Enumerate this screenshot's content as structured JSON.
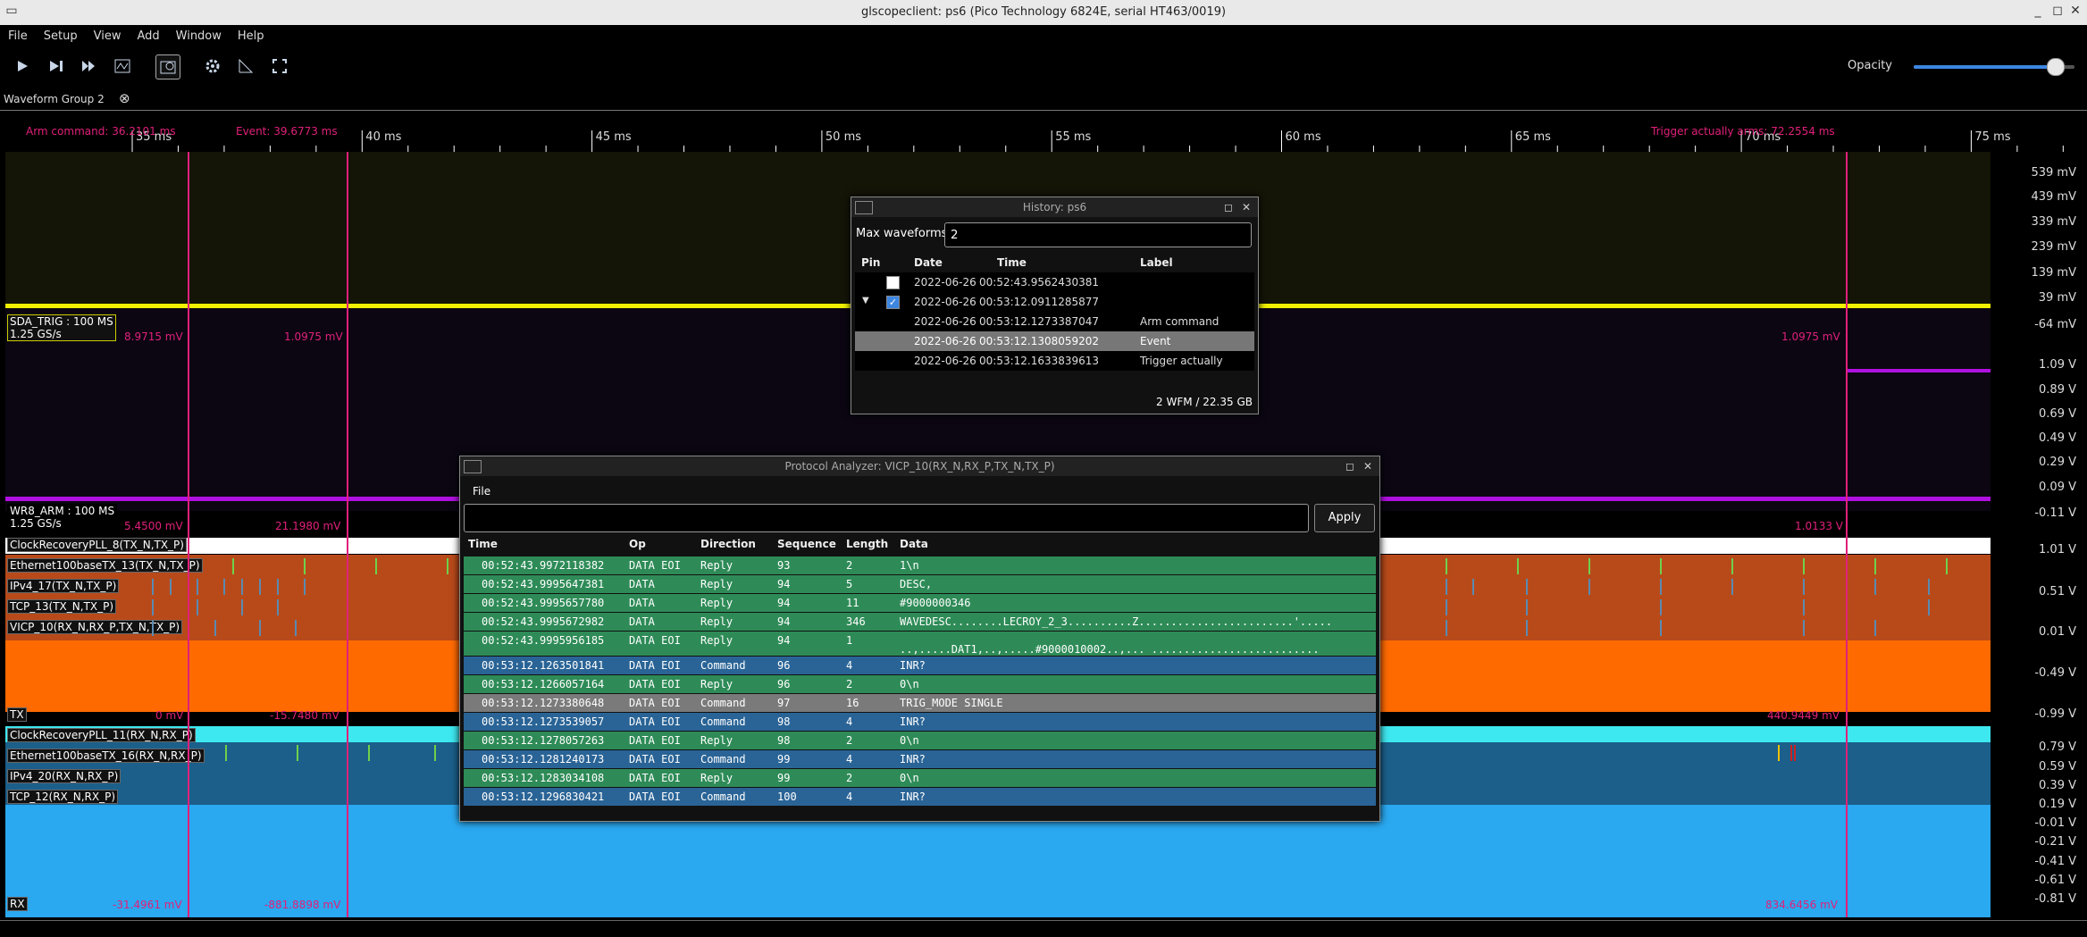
{
  "window": {
    "title": "glscopeclient: ps6 (Pico Technology 6824E, serial HT463/0019)",
    "min": "_",
    "max": "◻",
    "close": "✕"
  },
  "menu": [
    "File",
    "Setup",
    "View",
    "Add",
    "Window",
    "Help"
  ],
  "toolbar": {
    "opacity_label": "Opacity",
    "opacity_value": 0.88
  },
  "tab": {
    "label": "Waveform Group 2",
    "close": "⊗"
  },
  "ruler": {
    "ticks": [
      "35 ms",
      "40 ms",
      "45 ms",
      "50 ms",
      "55 ms",
      "60 ms",
      "65 ms",
      "70 ms",
      "75 ms"
    ],
    "markers": {
      "arm": "Arm command: 36.2101 ms",
      "event": "Event: 39.6773 ms",
      "trigger": "Trigger actually arms: 72.2554 ms"
    }
  },
  "scale": [
    "539 mV",
    "439 mV",
    "339 mV",
    "239 mV",
    "139 mV",
    "39 mV",
    "-64 mV",
    "1.09 V",
    "0.89 V",
    "0.69 V",
    "0.49 V",
    "0.29 V",
    "0.09 V",
    "-0.11 V",
    "1.01 V",
    "0.51 V",
    "0.01 V",
    "-0.49 V",
    "-0.99 V",
    "0.79 V",
    "0.59 V",
    "0.39 V",
    "0.19 V",
    "-0.01 V",
    "-0.21 V",
    "-0.41 V",
    "-0.61 V",
    "-0.81 V"
  ],
  "channels": {
    "sda_trig": {
      "name": "SDA_TRIG : 100 MS",
      "rate": "1.25 GS/s",
      "v1": "8.9715 mV",
      "v2": "1.0975 mV",
      "v3": "1.0975 mV"
    },
    "wr8_arm": {
      "name": "WR8_ARM : 100 MS",
      "rate": "1.25 GS/s",
      "v1": "5.4500 mV",
      "v2": "21.1980 mV",
      "v3": "1.0133 V"
    },
    "tx": {
      "name": "TX",
      "v1": "0 mV",
      "v2": "-15.7480 mV",
      "v3": "440.9449 mV"
    },
    "rx": {
      "name": "RX",
      "v1": "-31.4961 mV",
      "v2": "-881.8898 mV",
      "v3": "834.6456 mV"
    },
    "tx_decodes": [
      "ClockRecoveryPLL_8(TX_N,TX_P)",
      "Ethernet100baseTX_13(TX_N,TX_P)",
      "IPv4_17(TX_N,TX_P)",
      "TCP_13(TX_N,TX_P)",
      "VICP_10(RX_N,RX_P,TX_N,TX_P)"
    ],
    "rx_decodes": [
      "ClockRecoveryPLL_11(RX_N,RX_P)",
      "Ethernet100baseTX_16(RX_N,RX_P)",
      "IPv4_20(RX_N,RX_P)",
      "TCP_12(RX_N,RX_P)"
    ]
  },
  "history": {
    "title": "History: ps6",
    "max_label": "Max waveforms",
    "max_value": "2",
    "headers": [
      "Pin",
      "Date",
      "Time",
      "Label"
    ],
    "rows": [
      {
        "date": "2022-06-26",
        "time": "00:52:43.9562430381",
        "label": ""
      },
      {
        "date": "2022-06-26",
        "time": "00:53:12.0911285877",
        "label": ""
      },
      {
        "date": "2022-06-26",
        "time": "00:53:12.1273387047",
        "label": "Arm command"
      },
      {
        "date": "2022-06-26",
        "time": "00:53:12.1308059202",
        "label": "Event"
      },
      {
        "date": "2022-06-26",
        "time": "00:53:12.1633839613",
        "label": "Trigger actually"
      }
    ],
    "footer": "2 WFM / 22.35 GB"
  },
  "protocol": {
    "title": "Protocol Analyzer: VICP_10(RX_N,RX_P,TX_N,TX_P)",
    "menu": "File",
    "apply": "Apply",
    "headers": [
      "Time",
      "Op",
      "Direction",
      "Sequence",
      "Length",
      "Data"
    ],
    "rows": [
      {
        "time": "00:52:43.9972118382",
        "op": "DATA EOI",
        "dir": "Reply",
        "seq": "93",
        "len": "2",
        "data": "1\\n",
        "color": "#2e8b57"
      },
      {
        "time": "00:52:43.9995647381",
        "op": "DATA",
        "dir": "Reply",
        "seq": "94",
        "len": "5",
        "data": "DESC,",
        "color": "#2e8b57"
      },
      {
        "time": "00:52:43.9995657780",
        "op": "DATA",
        "dir": "Reply",
        "seq": "94",
        "len": "11",
        "data": "#9000000346",
        "color": "#2e8b57"
      },
      {
        "time": "00:52:43.9995672982",
        "op": "DATA",
        "dir": "Reply",
        "seq": "94",
        "len": "346",
        "data": "WAVEDESC........LECROY_2_3..........Z........................'.....",
        "color": "#2e8b57"
      },
      {
        "time": "00:52:43.9995956185",
        "op": "DATA EOI",
        "dir": "Reply",
        "seq": "94",
        "len": "1",
        "data": "..,.....DAT1,..,.....#9000010002..,... ..........................",
        "color": "#2e8b57"
      },
      {
        "time": "00:53:12.1263501841",
        "op": "DATA EOI",
        "dir": "Command",
        "seq": "96",
        "len": "4",
        "data": "INR?",
        "color": "#2a6496"
      },
      {
        "time": "00:53:12.1266057164",
        "op": "DATA EOI",
        "dir": "Reply",
        "seq": "96",
        "len": "2",
        "data": "0\\n",
        "color": "#2e8b57"
      },
      {
        "time": "00:53:12.1273380648",
        "op": "DATA EOI",
        "dir": "Command",
        "seq": "97",
        "len": "16",
        "data": "TRIG_MODE SINGLE",
        "color": "#7a7a7a"
      },
      {
        "time": "00:53:12.1273539057",
        "op": "DATA EOI",
        "dir": "Command",
        "seq": "98",
        "len": "4",
        "data": "INR?",
        "color": "#2a6496"
      },
      {
        "time": "00:53:12.1278057263",
        "op": "DATA EOI",
        "dir": "Reply",
        "seq": "98",
        "len": "2",
        "data": "0\\n",
        "color": "#2e8b57"
      },
      {
        "time": "00:53:12.1281240173",
        "op": "DATA EOI",
        "dir": "Command",
        "seq": "99",
        "len": "4",
        "data": "INR?",
        "color": "#2a6496"
      },
      {
        "time": "00:53:12.1283034108",
        "op": "DATA EOI",
        "dir": "Reply",
        "seq": "99",
        "len": "2",
        "data": "0\\n",
        "color": "#2e8b57"
      },
      {
        "time": "00:53:12.1296830421",
        "op": "DATA EOI",
        "dir": "Command",
        "seq": "100",
        "len": "4",
        "data": "INR?",
        "color": "#2a6496"
      }
    ]
  }
}
